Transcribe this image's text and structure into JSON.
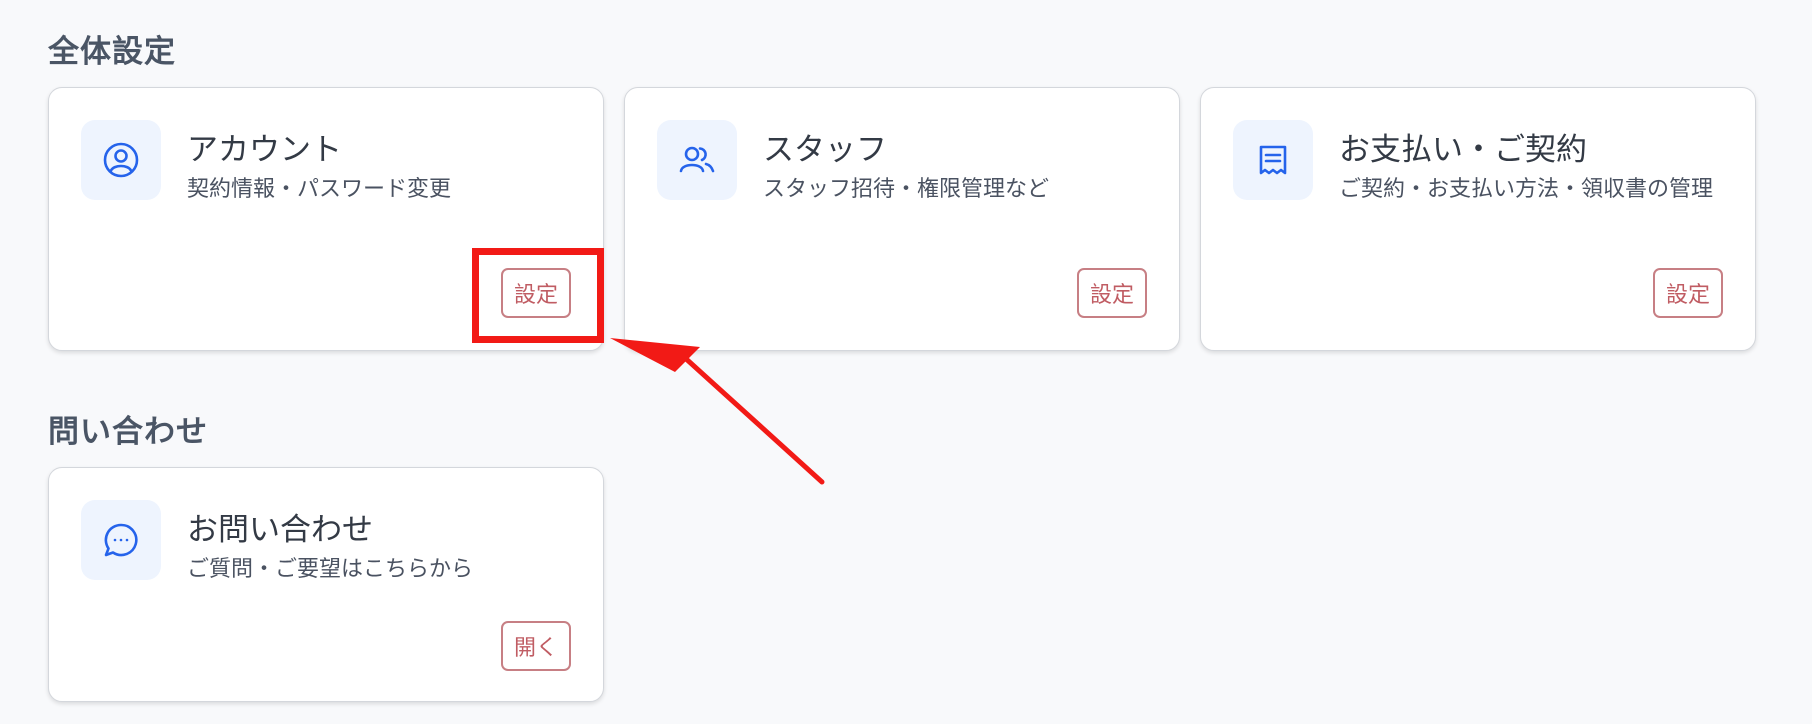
{
  "sections": {
    "general": {
      "title": "全体設定",
      "cards": [
        {
          "title": "アカウント",
          "description": "契約情報・パスワード変更",
          "button_label": "設定",
          "icon": "user-circle-icon"
        },
        {
          "title": "スタッフ",
          "description": "スタッフ招待・権限管理など",
          "button_label": "設定",
          "icon": "users-icon"
        },
        {
          "title": "お支払い・ご契約",
          "description": "ご契約・お支払い方法・領収書の管理",
          "button_label": "設定",
          "icon": "receipt-icon"
        }
      ]
    },
    "inquiry": {
      "title": "問い合わせ",
      "cards": [
        {
          "title": "お問い合わせ",
          "description": "ご質問・ご要望はこちらから",
          "button_label": "開く",
          "icon": "chat-bubble-icon"
        }
      ]
    }
  },
  "colors": {
    "background": "#f8f9fb",
    "icon_accent": "#2563eb",
    "icon_tile": "#eef4fe",
    "button_border": "#c77f84",
    "button_text": "#c05c63",
    "annotation": "#f21a16"
  }
}
